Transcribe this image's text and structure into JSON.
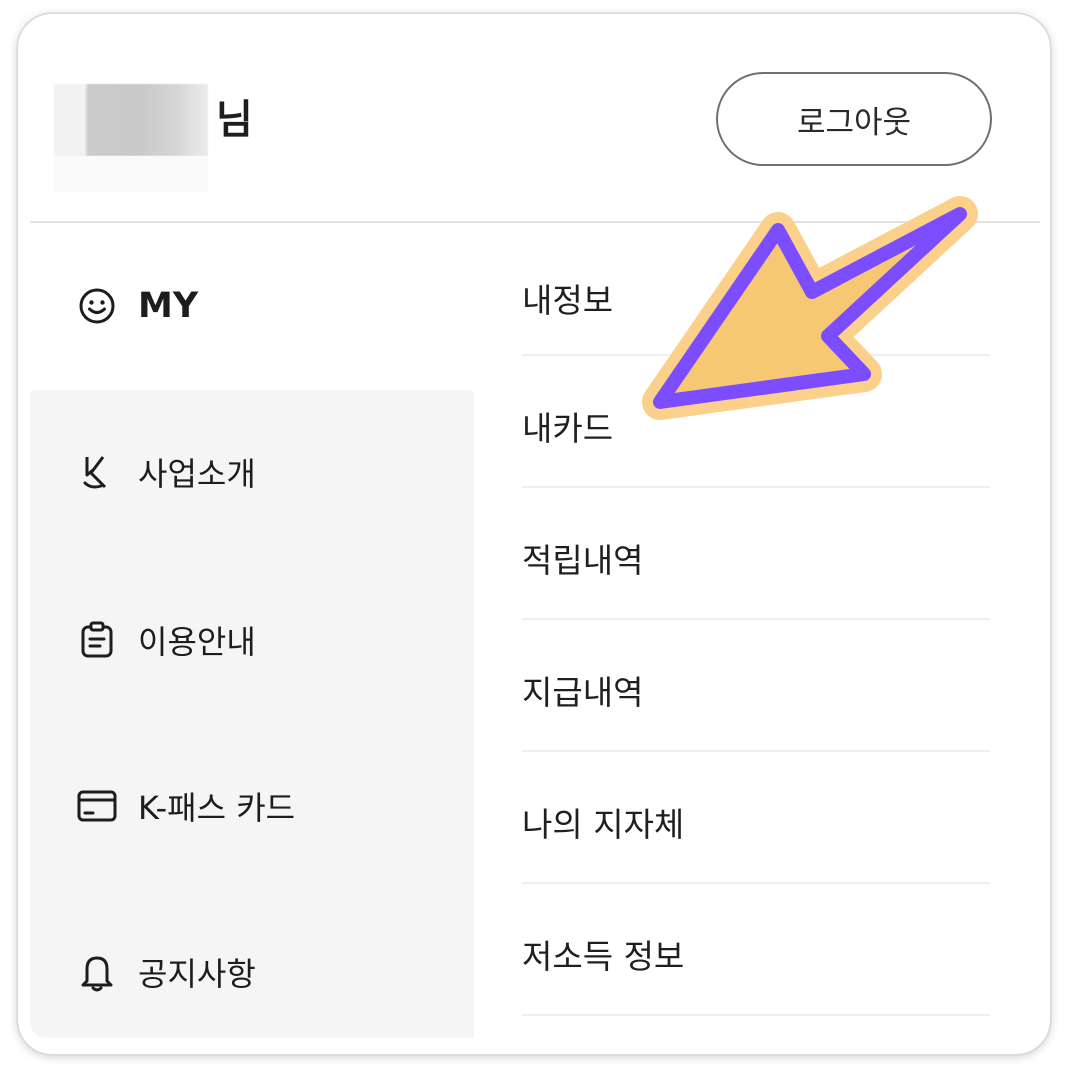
{
  "header": {
    "user_suffix": "님",
    "logout_label": "로그아웃"
  },
  "sidebar": {
    "items": [
      {
        "label": "MY",
        "icon": "smiley-icon"
      },
      {
        "label": "사업소개",
        "icon": "k-logo-icon"
      },
      {
        "label": "이용안내",
        "icon": "clipboard-icon"
      },
      {
        "label": "K-패스 카드",
        "icon": "card-icon"
      },
      {
        "label": "공지사항",
        "icon": "bell-icon"
      }
    ]
  },
  "submenu": {
    "items": [
      {
        "label": "내정보"
      },
      {
        "label": "내카드"
      },
      {
        "label": "적립내역"
      },
      {
        "label": "지급내역"
      },
      {
        "label": "나의 지자체"
      },
      {
        "label": "저소득 정보"
      }
    ]
  },
  "annotation": {
    "icon": "pointer-arrow-icon",
    "fill_color": "#f7c873",
    "stroke_color": "#7b4dff",
    "halo_color": "#fbd08a"
  },
  "colors": {
    "card_bg": "#ffffff",
    "sidebar_bg": "#f5f5f5",
    "divider": "#e2e2e2",
    "text": "#1d1d1d"
  }
}
